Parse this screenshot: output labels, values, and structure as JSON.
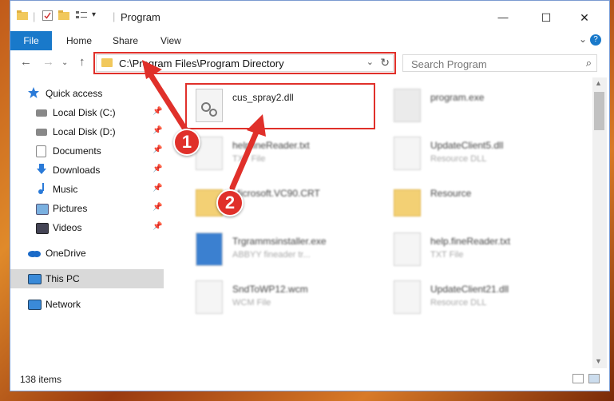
{
  "window": {
    "title": "Program",
    "minimize": "—",
    "maximize": "☐",
    "close": "✕"
  },
  "ribbon": {
    "tabs": [
      "File",
      "Home",
      "Share",
      "View"
    ],
    "expand": "⌄",
    "help": "?"
  },
  "nav": {
    "back": "←",
    "forward": "→",
    "up": "↑",
    "recent": "⌄",
    "address": "C:\\Program Files\\Program Directory",
    "search_placeholder": "Search Program"
  },
  "sidebar": {
    "items": [
      {
        "label": "Quick access",
        "icon": "star-icon",
        "pinned": false
      },
      {
        "label": "Local Disk (C:)",
        "icon": "drive-icon",
        "pinned": true
      },
      {
        "label": "Local Disk (D:)",
        "icon": "drive-icon",
        "pinned": true
      },
      {
        "label": "Documents",
        "icon": "documents-icon",
        "pinned": true
      },
      {
        "label": "Downloads",
        "icon": "download-icon",
        "pinned": true
      },
      {
        "label": "Music",
        "icon": "music-icon",
        "pinned": true
      },
      {
        "label": "Pictures",
        "icon": "pictures-icon",
        "pinned": true
      },
      {
        "label": "Videos",
        "icon": "videos-icon",
        "pinned": true
      },
      {
        "label": "OneDrive",
        "icon": "cloud-icon",
        "pinned": false
      },
      {
        "label": "This PC",
        "icon": "computer-icon",
        "pinned": false,
        "selected": true
      },
      {
        "label": "Network",
        "icon": "network-icon",
        "pinned": false
      }
    ]
  },
  "files": [
    {
      "name": "cus_spray2.dll",
      "type": "",
      "icon": "dll-gear-icon"
    },
    {
      "name": "program.exe",
      "type": "",
      "icon": "exe-icon"
    },
    {
      "name": "helpfineReader.txt",
      "type": "TXT File",
      "icon": "txt-icon"
    },
    {
      "name": "UpdateClient5.dll",
      "type": "Resource DLL",
      "icon": "dll-gear-icon"
    },
    {
      "name": "Microsoft.VC90.CRT",
      "type": "",
      "icon": "folder-icon"
    },
    {
      "name": "Resource",
      "type": "",
      "icon": "folder-icon"
    },
    {
      "name": "Trgrammsinstaller.exe",
      "type": "ABBYY fineader tr...",
      "icon": "installer-icon"
    },
    {
      "name": "help.fineReader.txt",
      "type": "TXT File",
      "icon": "txt-icon"
    },
    {
      "name": "SndToWP12.wcm",
      "type": "WCM File",
      "icon": "file-icon"
    },
    {
      "name": "UpdateClient21.dll",
      "type": "Resource DLL",
      "icon": "dll-gear-icon"
    }
  ],
  "annotations": {
    "step1": "1",
    "step2": "2",
    "highlight_color": "#e0302a"
  },
  "status": {
    "item_count": "138 items"
  }
}
